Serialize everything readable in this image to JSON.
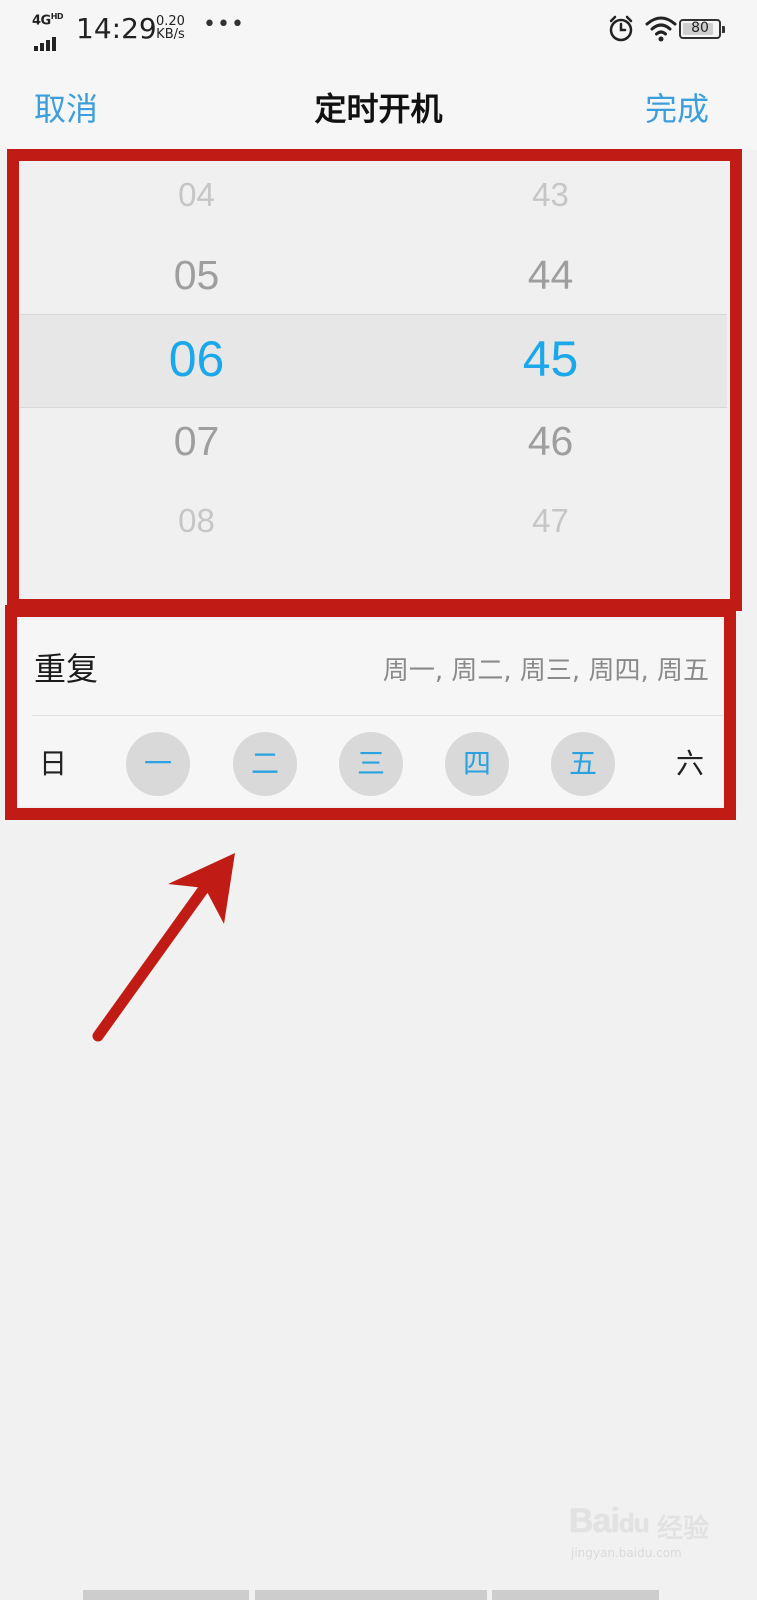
{
  "status_bar": {
    "network": "4G",
    "network_hd": "HD",
    "time": "14:29",
    "speed_value": "0.20",
    "speed_unit": "KB/s",
    "more": "•••",
    "battery": "80",
    "icons": [
      "signal-icon",
      "alarm-icon",
      "wifi-icon",
      "battery-icon"
    ]
  },
  "nav": {
    "cancel": "取消",
    "title": "定时开机",
    "done": "完成"
  },
  "picker": {
    "hours": [
      "04",
      "05",
      "06",
      "07",
      "08"
    ],
    "minutes": [
      "43",
      "44",
      "45",
      "46",
      "47"
    ],
    "selected_hour": "06",
    "selected_minute": "45"
  },
  "repeat": {
    "label": "重复",
    "summary": "周一, 周二, 周三, 周四, 周五",
    "days": [
      {
        "label": "日",
        "selected": false
      },
      {
        "label": "一",
        "selected": true
      },
      {
        "label": "二",
        "selected": true
      },
      {
        "label": "三",
        "selected": true
      },
      {
        "label": "四",
        "selected": true
      },
      {
        "label": "五",
        "selected": true
      },
      {
        "label": "六",
        "selected": false
      }
    ]
  },
  "watermark": {
    "brand": "Bai",
    "brand_suffix": "du",
    "cn": "经验",
    "url": "jingyan.baidu.com"
  },
  "colors": {
    "accent": "#3c9fdc",
    "selected": "#1ba8ea",
    "highlight_frame": "#c01c15",
    "day_selected_bg": "#d9d9d9"
  }
}
